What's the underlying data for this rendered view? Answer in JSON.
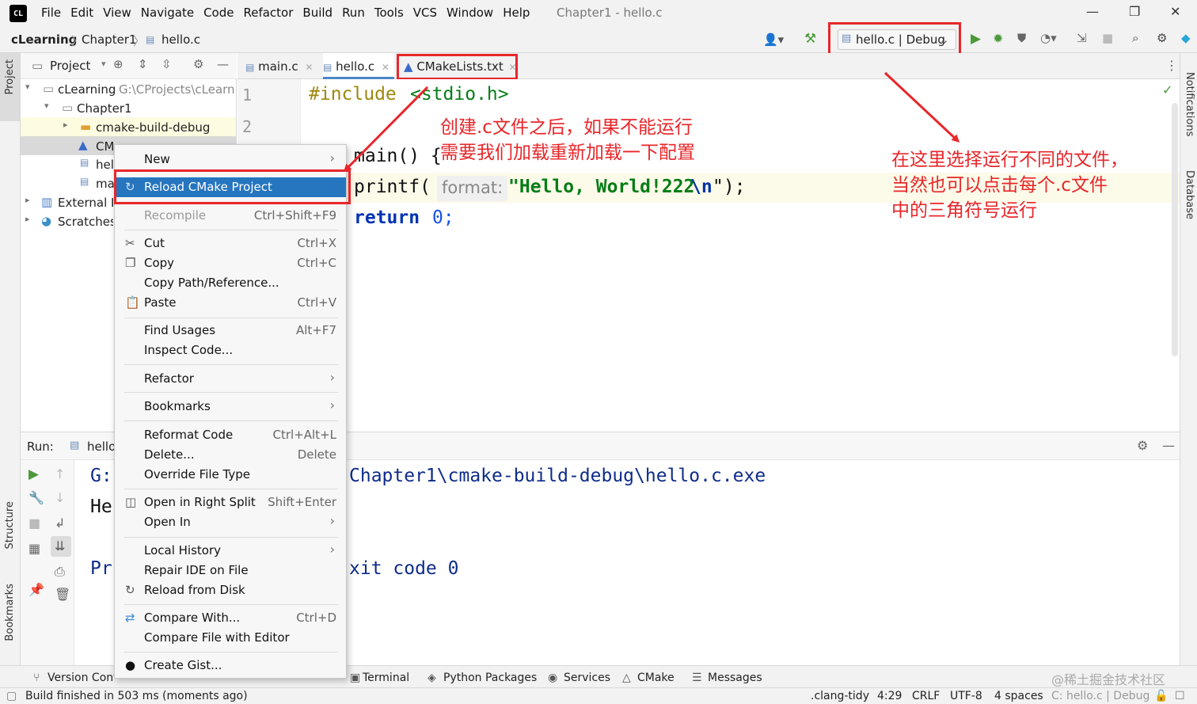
{
  "menubar": {
    "items": [
      "File",
      "Edit",
      "View",
      "Navigate",
      "Code",
      "Refactor",
      "Build",
      "Run",
      "Tools",
      "VCS",
      "Window",
      "Help"
    ],
    "title": "Chapter1 - hello.c"
  },
  "navbar": {
    "crumbs": [
      "cLearning",
      "Chapter1",
      "hello.c"
    ],
    "run_config": "hello.c | Debug"
  },
  "left_strip": {
    "project": "Project",
    "structure": "Structure",
    "bookmarks": "Bookmarks"
  },
  "right_strip": {
    "notifications": "Notifications",
    "database": "Database"
  },
  "project": {
    "header": "Project",
    "root": "cLearning",
    "root_path": "G:\\CProjects\\cLearning",
    "chapter": "Chapter1",
    "build_dir": "cmake-build-debug",
    "cmakelists": "CMakeLists.txt",
    "hello": "hello.c",
    "main": "main.c",
    "external": "External Libraries",
    "scratches": "Scratches and Consoles"
  },
  "tabs": [
    {
      "label": "main.c"
    },
    {
      "label": "hello.c"
    },
    {
      "label": "CMakeLists.txt"
    }
  ],
  "editor": {
    "line_numbers": [
      "1",
      "2"
    ],
    "include_kw": "#include",
    "include_file": "<stdio.h>",
    "line3": "main() {",
    "printf": "printf(",
    "hint": "format:",
    "string": "\"Hello, World!222",
    "escape": "\\n",
    "close": "\");",
    "return_kw": "return",
    "zero": "0;"
  },
  "run": {
    "label": "Run:",
    "tab": "hello",
    "out1_prefix": "G:",
    "out1": "Chapter1\\cmake-build-debug\\hello.c.exe",
    "out2_prefix": "He",
    "out3_prefix": "Pr",
    "out3": "xit code 0"
  },
  "context_menu": {
    "new": "New",
    "reload": "Reload CMake Project",
    "recompile": "Recompile",
    "recompile_sc": "Ctrl+Shift+F9",
    "cut": "Cut",
    "cut_sc": "Ctrl+X",
    "copy": "Copy",
    "copy_sc": "Ctrl+C",
    "copy_path": "Copy Path/Reference...",
    "paste": "Paste",
    "paste_sc": "Ctrl+V",
    "find_usages": "Find Usages",
    "find_usages_sc": "Alt+F7",
    "inspect": "Inspect Code...",
    "refactor": "Refactor",
    "bookmarks": "Bookmarks",
    "reformat": "Reformat Code",
    "reformat_sc": "Ctrl+Alt+L",
    "delete": "Delete...",
    "delete_sc": "Delete",
    "override": "Override File Type",
    "open_right": "Open in Right Split",
    "open_right_sc": "Shift+Enter",
    "open_in": "Open In",
    "local_history": "Local History",
    "repair": "Repair IDE on File",
    "reload_disk": "Reload from Disk",
    "compare": "Compare With...",
    "compare_sc": "Ctrl+D",
    "compare_editor": "Compare File with Editor",
    "gist": "Create Gist..."
  },
  "bottom_bar": {
    "version": "Version Control",
    "terminal": "Terminal",
    "python": "Python Packages",
    "services": "Services",
    "cmake": "CMake",
    "messages": "Messages"
  },
  "status": {
    "build": "Build finished in 503 ms (moments ago)",
    "clang": ".clang-tidy",
    "pos": "4:29",
    "eol": "CRLF",
    "enc": "UTF-8",
    "indent": "4 spaces",
    "ctx": "C: hello.c | Debug"
  },
  "annotations": {
    "a1_l1": "创建.c文件之后，如果不能运行",
    "a1_l2": "需要我们加载重新加载一下配置",
    "a2_l1": "在这里选择运行不同的文件，",
    "a2_l2": "当然也可以点击每个.c文件",
    "a2_l3": "中的三角符号运行"
  },
  "watermark": "@稀土掘金技术社区",
  "colors": {
    "annotation": "#e8262a",
    "selection": "#2675bf",
    "keyword": "#0033b3",
    "string": "#067d17"
  }
}
